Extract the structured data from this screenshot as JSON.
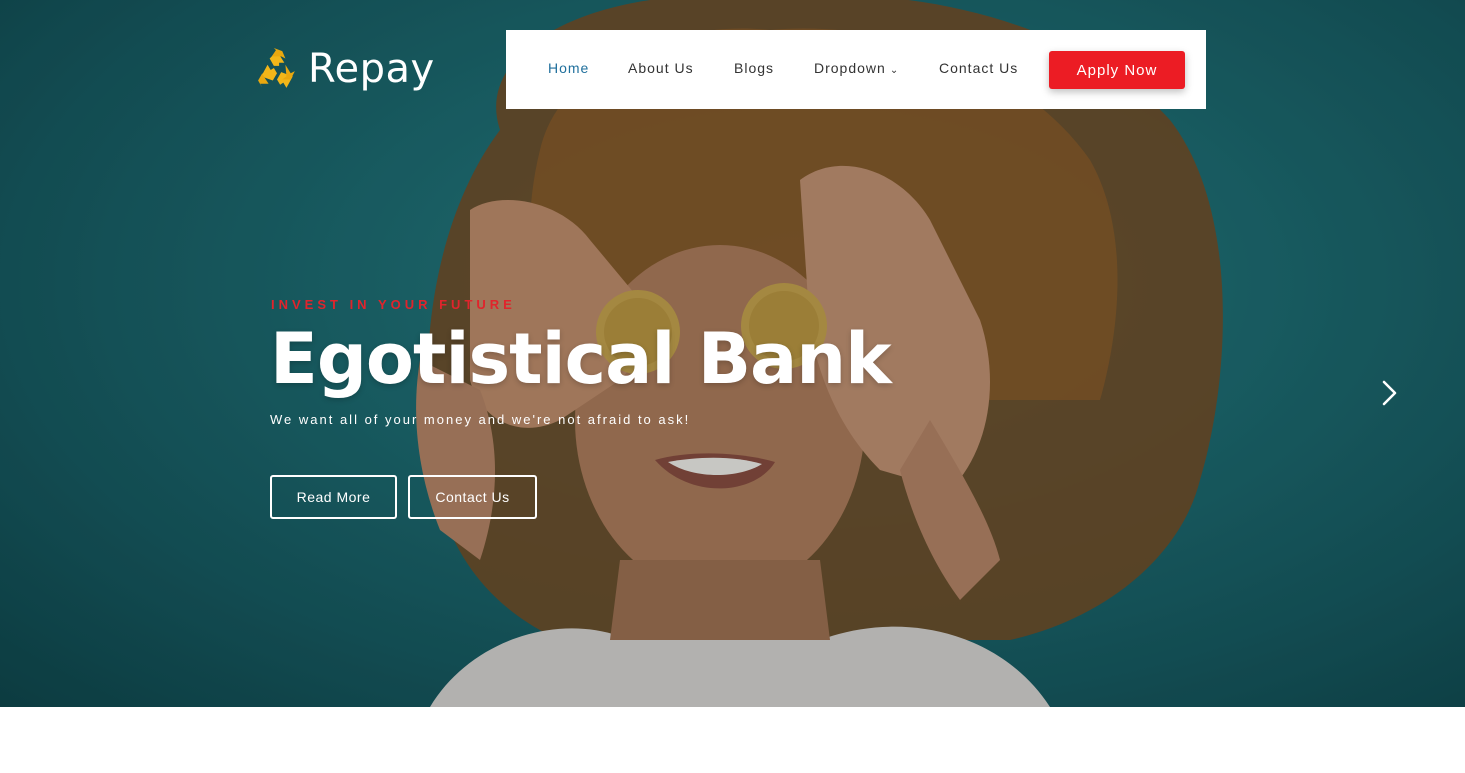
{
  "brand": {
    "name": "Repay",
    "icon": "recycle-icon",
    "icon_color": "#f2b619"
  },
  "nav": {
    "items": [
      {
        "label": "Home",
        "active": true
      },
      {
        "label": "About Us"
      },
      {
        "label": "Blogs"
      },
      {
        "label": "Dropdown"
      },
      {
        "label": "Contact Us"
      }
    ],
    "cta_label": "Apply Now"
  },
  "hero": {
    "eyebrow": "INVEST IN YOUR FUTURE",
    "title": "Egotistical Bank",
    "subtitle": "We want all of your money and we're not afraid to ask!",
    "buttons": {
      "primary": "Read More",
      "secondary": "Contact Us"
    },
    "next_icon": "chevron-right-icon"
  },
  "colors": {
    "accent": "#ec1c24",
    "active_nav": "#1f6f9c",
    "hero_background": "#1f6d72",
    "logo_icon": "#f2b619"
  }
}
